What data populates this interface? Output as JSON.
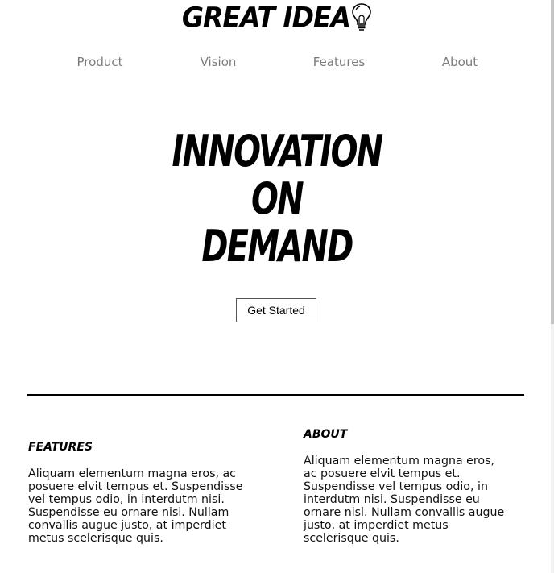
{
  "logo": {
    "text": "GREAT IDEA",
    "icon": "lightbulb-icon"
  },
  "nav": {
    "items": [
      {
        "label": "Product"
      },
      {
        "label": "Vision"
      },
      {
        "label": "Features"
      },
      {
        "label": "About"
      }
    ]
  },
  "hero": {
    "lines": [
      "INNOVATION",
      "ON",
      "DEMAND"
    ],
    "cta_label": "Get Started"
  },
  "sections": {
    "features": {
      "heading": "FEATURES",
      "body": "Aliquam elementum magna eros, ac posuere elvit tempus et. Suspendisse vel tempus odio, in interdutm nisi. Suspendisse eu ornare nisl. Nullam convallis augue justo, at imperdiet metus scelerisque quis."
    },
    "about": {
      "heading": "ABOUT",
      "body": "Aliquam elementum magna eros, ac posuere elvit tempus et. Suspendisse vel tempus odio, in interdutm nisi. Suspendisse eu ornare nisl. Nullam convallis augue justo, at imperdiet metus scelerisque quis."
    }
  }
}
